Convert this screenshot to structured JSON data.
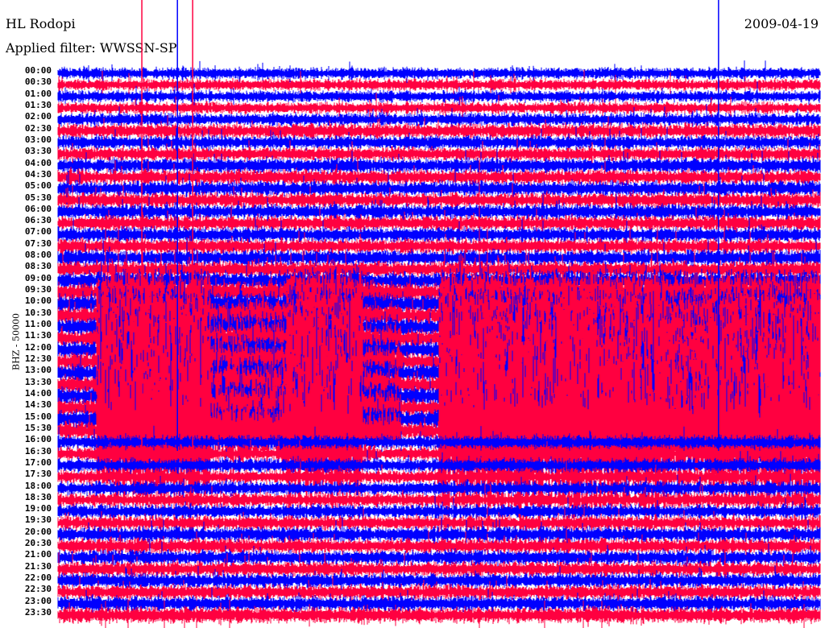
{
  "header": {
    "station": "HL Rodopi",
    "filter": "Applied filter: WWSSN-SP",
    "date": "2009-04-19"
  },
  "chart_data": {
    "type": "line",
    "title": "HL Rodopi",
    "subtitle": "Applied filter: WWSSN-SP",
    "ylabel": "BHZ - 50000",
    "row_minutes": 30,
    "row_labels": [
      "00:00",
      "00:30",
      "01:00",
      "01:30",
      "02:00",
      "02:30",
      "03:00",
      "03:30",
      "04:00",
      "04:30",
      "05:00",
      "05:30",
      "06:00",
      "06:30",
      "07:00",
      "07:30",
      "08:00",
      "08:30",
      "09:00",
      "09:30",
      "10:00",
      "10:30",
      "11:00",
      "11:30",
      "12:00",
      "12:30",
      "13:00",
      "13:30",
      "14:00",
      "14:30",
      "15:00",
      "15:30",
      "16:00",
      "16:30",
      "17:00",
      "17:30",
      "18:00",
      "18:30",
      "19:00",
      "19:30",
      "20:00",
      "20:30",
      "21:00",
      "21:30",
      "22:00",
      "22:30",
      "23:00",
      "23:30"
    ],
    "series_colors": [
      "#0000ff",
      "#ff0040"
    ],
    "base_amplitude": [
      1.0,
      1.0,
      1.0,
      1.0,
      1.1,
      1.3,
      1.2,
      1.2,
      1.3,
      1.3,
      1.3,
      1.3,
      1.3,
      1.3,
      1.3,
      1.3,
      1.4,
      1.4,
      1.5,
      1.6,
      1.6,
      1.6,
      1.6,
      1.6,
      1.6,
      1.6,
      1.6,
      1.6,
      1.6,
      1.6,
      1.6,
      1.6,
      1.2,
      1.2,
      1.2,
      1.2,
      1.2,
      1.2,
      1.2,
      1.2,
      1.3,
      1.3,
      1.3,
      1.3,
      1.3,
      1.3,
      1.3,
      1.4
    ],
    "disturbance_profile_bins": [
      1,
      8,
      8,
      8,
      3,
      3,
      8,
      8,
      2,
      1,
      8,
      8,
      8,
      8,
      8,
      8,
      6,
      8,
      8,
      8
    ],
    "disturbance_rows": [
      18,
      19,
      20,
      21,
      22,
      23,
      24,
      25,
      26,
      27,
      28,
      29,
      30,
      31
    ],
    "spikes_minute": [
      3.3,
      4.7,
      5.3,
      26
    ]
  }
}
